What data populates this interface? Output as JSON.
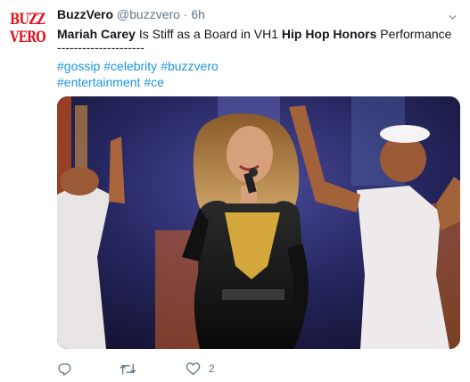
{
  "tweet": {
    "avatar_line1": "BUZZ",
    "avatar_line2": "VERO",
    "display_name": "BuzzVero",
    "handle": "@buzzvero",
    "separator": "·",
    "time": "6h",
    "text_bold1": "Mariah Carey",
    "text_mid": " Is Stiff as a Board in VH1 ",
    "text_bold2": "Hip Hop Honors",
    "text_end": " Performance",
    "dashes": "---------------------",
    "hashtags_line1": [
      "#gossip",
      "#celebrity",
      "#buzzvero"
    ],
    "hashtags_line2": [
      "#entertainment",
      "#ce"
    ],
    "like_count": "2"
  },
  "icons": {
    "caret": "chevron-down-icon",
    "reply": "reply-icon",
    "retweet": "retweet-icon",
    "like": "heart-icon"
  },
  "colors": {
    "text": "#14171a",
    "secondary": "#657786",
    "link": "#1b95e0",
    "brand_red": "#e0141d"
  }
}
